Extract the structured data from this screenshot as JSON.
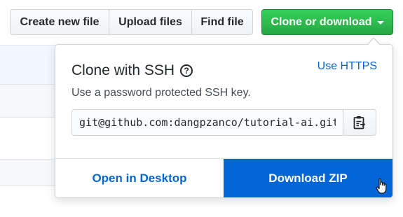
{
  "toolbar": {
    "create_new_file_label": "Create new file",
    "upload_files_label": "Upload files",
    "find_file_label": "Find file",
    "clone_or_download_label": "Clone or download"
  },
  "clone_panel": {
    "title": "Clone with SSH",
    "help_glyph": "?",
    "switch_link_label": "Use HTTPS",
    "description": "Use a password protected SSH key.",
    "clone_url_value": "git@github.com:dangpzanco/tutorial-ai.git",
    "open_desktop_label": "Open in Desktop",
    "download_zip_label": "Download ZIP"
  },
  "icons": {
    "caret": "chevron-down-icon",
    "help": "question-circle-icon",
    "copy": "clipboard-icon",
    "cursor": "hand-pointer-cursor-icon"
  },
  "colors": {
    "primary_green": "#28a745",
    "link_blue": "#0366d6",
    "download_bg": "#0366d6",
    "text": "#24292e",
    "muted_text": "#444d56",
    "border": "#d1d5da",
    "selected_row_bg": "#f1f8ff"
  }
}
